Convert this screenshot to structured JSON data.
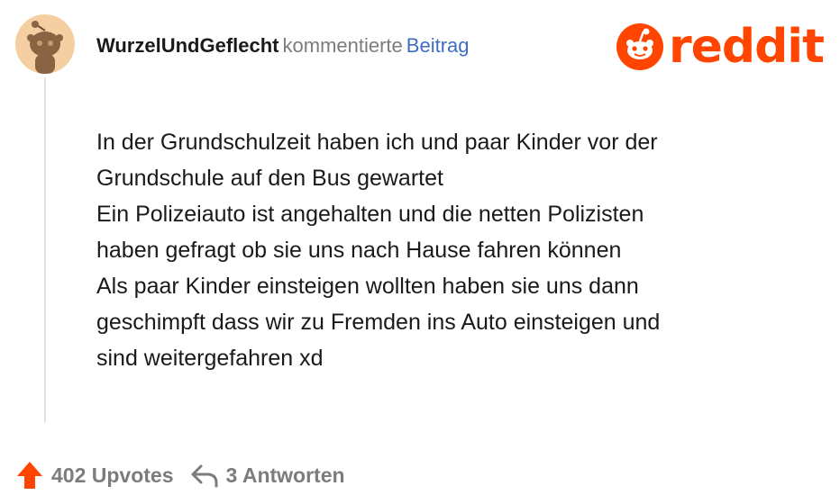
{
  "comment": {
    "username": "WurzelUndGeflecht",
    "action": "kommentierte",
    "post_link": "Beitrag",
    "body_lines": [
      "In der Grundschulzeit haben ich und paar Kinder vor der",
      "Grundschule auf den Bus gewartet",
      "Ein Polizeiauto ist angehalten und die netten Polizisten",
      "haben gefragt ob sie uns nach Hause fahren können",
      "Als paar Kinder einsteigen wollten haben sie uns dann",
      "geschimpft dass wir zu Fremden ins Auto einsteigen und",
      "sind weitergefahren xd"
    ]
  },
  "footer": {
    "upvotes": "402 Upvotes",
    "replies": "3 Antworten"
  },
  "brand": {
    "logo_text": "reddit",
    "accent_color": "#ff4500",
    "link_color": "#3e6ec2",
    "avatar_color": "#f5cfa2"
  },
  "icons": {
    "avatar": "snoo-avatar-icon",
    "logo": "reddit-snoo-icon",
    "upvote": "upvote-arrow-icon",
    "reply": "reply-arrow-icon"
  }
}
